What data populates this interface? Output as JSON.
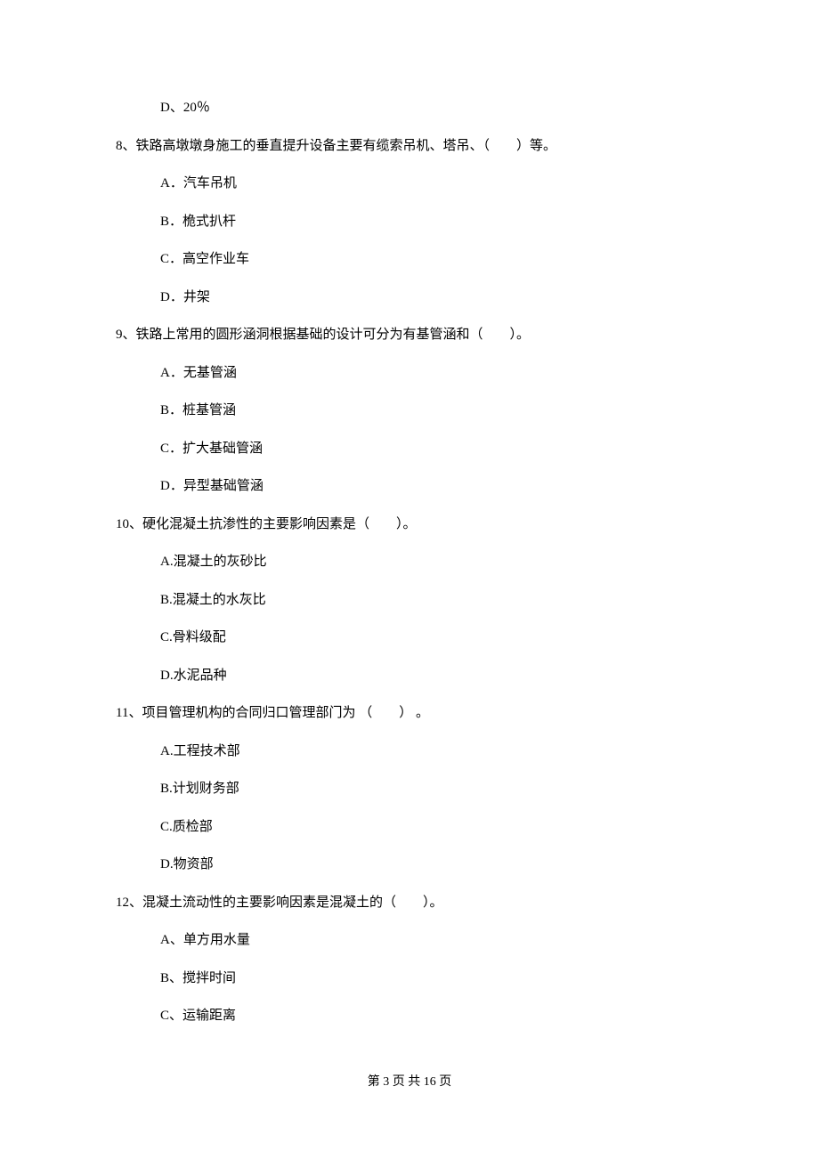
{
  "prev_q_last_option": "D、20％",
  "questions": [
    {
      "num": "8、",
      "text": "铁路高墩墩身施工的垂直提升设备主要有缆索吊机、塔吊、（　　）等。",
      "options": [
        "A．汽车吊机",
        "B．桅式扒杆",
        "C．高空作业车",
        "D．井架"
      ]
    },
    {
      "num": "9、",
      "text": "铁路上常用的圆形涵洞根据基础的设计可分为有基管涵和（　　）。",
      "options": [
        "A．无基管涵",
        "B．桩基管涵",
        "C．扩大基础管涵",
        "D．异型基础管涵"
      ]
    },
    {
      "num": "10、",
      "text": "硬化混凝土抗渗性的主要影响因素是（　　）。",
      "options": [
        "A.混凝土的灰砂比",
        "B.混凝土的水灰比",
        "C.骨料级配",
        "D.水泥品种"
      ]
    },
    {
      "num": "11、",
      "text": "项目管理机构的合同归口管理部门为 （　　） 。",
      "options": [
        "A.工程技术部",
        "B.计划财务部",
        "C.质检部",
        "D.物资部"
      ]
    },
    {
      "num": "12、",
      "text": "混凝土流动性的主要影响因素是混凝土的（　　）。",
      "options": [
        "A、单方用水量",
        "B、搅拌时间",
        "C、运输距离"
      ]
    }
  ],
  "footer": "第 3 页 共 16 页"
}
